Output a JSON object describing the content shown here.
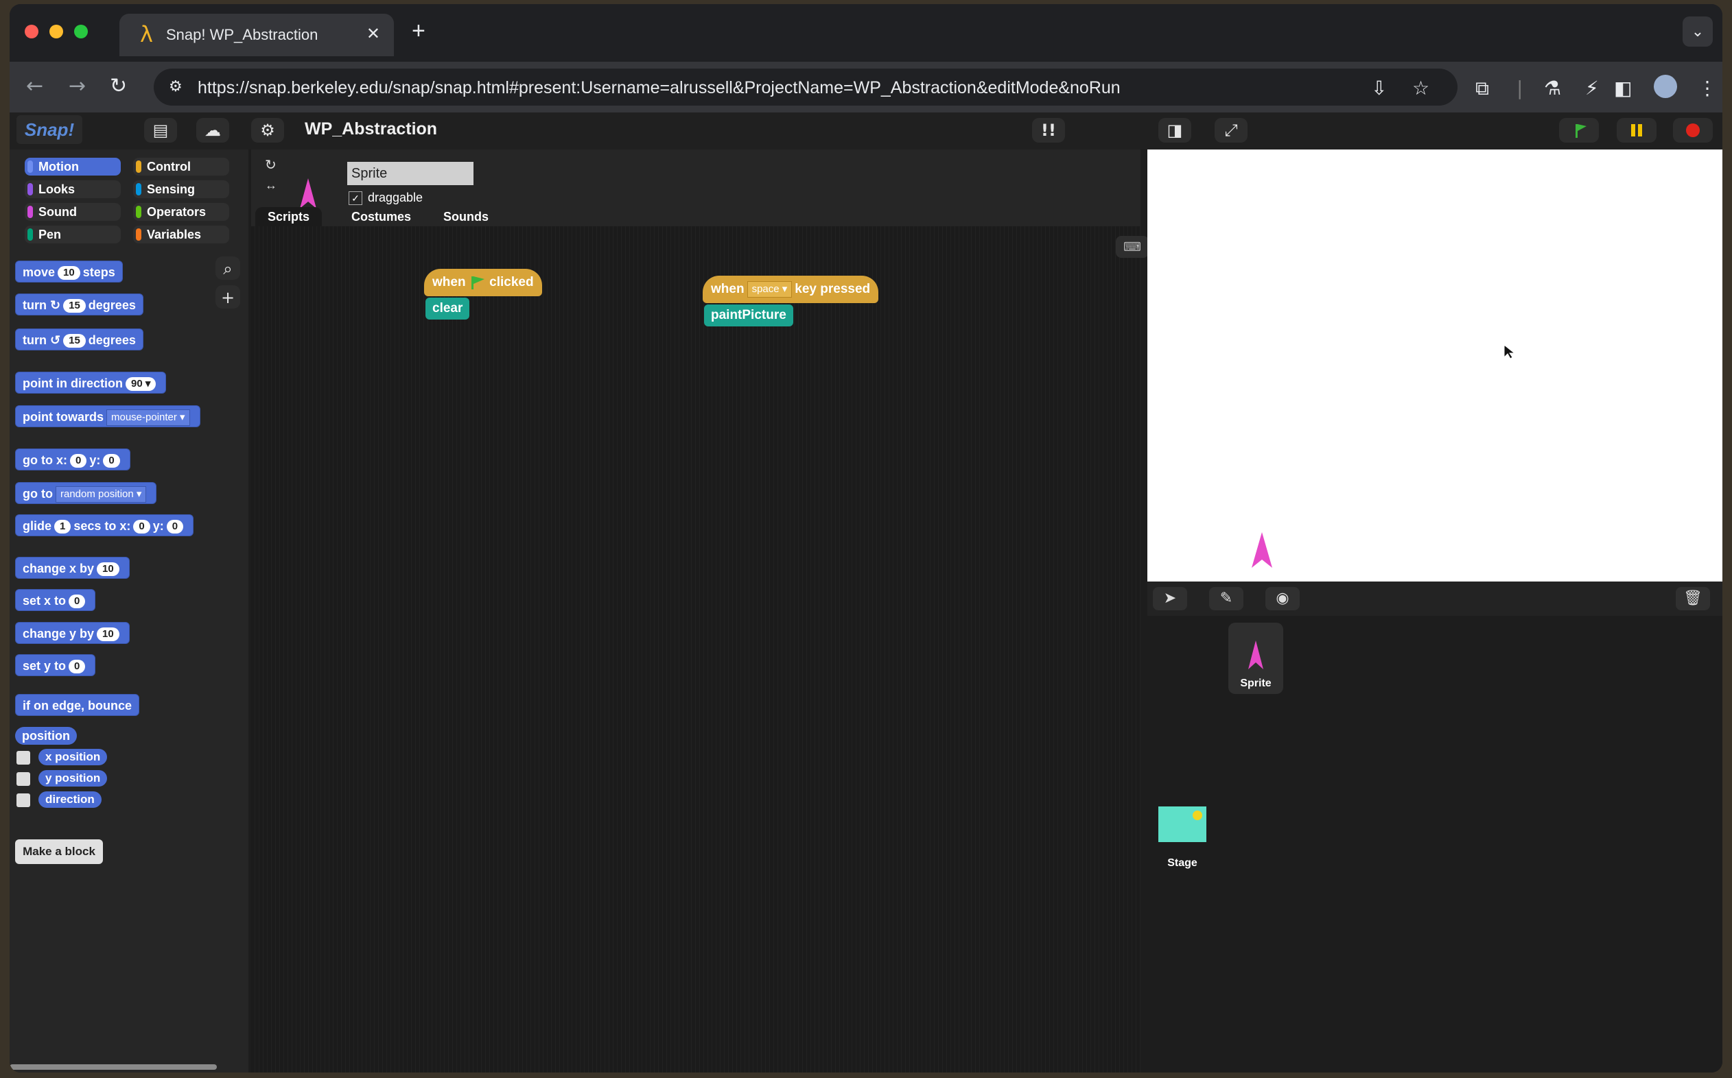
{
  "browser": {
    "tab_title": "Snap! WP_Abstraction",
    "tab_icon": "λ",
    "tab_close": "✕",
    "new_tab": "+",
    "tab_menu": "⌄",
    "url": "https://snap.berkeley.edu/snap/snap.html#present:Username=alrussell&ProjectName=WP_Abstraction&editMode&noRun"
  },
  "snap": {
    "logo": "Snap!",
    "project_name": "WP_Abstraction",
    "categories": [
      {
        "label": "Motion",
        "color": "#4a6cd4"
      },
      {
        "label": "Control",
        "color": "#e6a822"
      },
      {
        "label": "Looks",
        "color": "#8f56e3"
      },
      {
        "label": "Sensing",
        "color": "#0494dc"
      },
      {
        "label": "Sound",
        "color": "#cf4ad9"
      },
      {
        "label": "Operators",
        "color": "#62c213"
      },
      {
        "label": "Pen",
        "color": "#00a178"
      },
      {
        "label": "Variables",
        "color": "#f3761d"
      }
    ],
    "blocks": {
      "move": {
        "a": "move",
        "v": "10",
        "b": "steps"
      },
      "turn_cw": {
        "a": "turn",
        "icon": "↻",
        "v": "15",
        "b": "degrees"
      },
      "turn_ccw": {
        "a": "turn",
        "icon": "↺",
        "v": "15",
        "b": "degrees"
      },
      "point_dir": {
        "a": "point in direction",
        "v": "90"
      },
      "point_towards": {
        "a": "point towards",
        "v": "mouse-pointer"
      },
      "goto_xy": {
        "a": "go to x:",
        "x": "0",
        "b": "y:",
        "y": "0"
      },
      "goto": {
        "a": "go to",
        "v": "random position"
      },
      "glide": {
        "a": "glide",
        "v": "1",
        "b": "secs to x:",
        "x": "0",
        "c": "y:",
        "y": "0"
      },
      "change_x": {
        "a": "change x by",
        "v": "10"
      },
      "set_x": {
        "a": "set x to",
        "v": "0"
      },
      "change_y": {
        "a": "change y by",
        "v": "10"
      },
      "set_y": {
        "a": "set y to",
        "v": "0"
      },
      "bounce": "if on edge, bounce",
      "position": "position",
      "x_position": "x position",
      "y_position": "y position",
      "direction": "direction"
    },
    "make_block": "Make a block",
    "sprite_name": "Sprite",
    "draggable_label": "draggable",
    "draggable_check": "✓",
    "tabs": [
      "Scripts",
      "Costumes",
      "Sounds"
    ],
    "scripts": {
      "green_flag": {
        "a": "when",
        "b": "clicked",
        "command": "clear"
      },
      "key": {
        "a": "when",
        "key": "space",
        "b": "key pressed",
        "command": "paintPicture"
      }
    },
    "corral": {
      "sprite": "Sprite",
      "stage": "Stage"
    }
  }
}
